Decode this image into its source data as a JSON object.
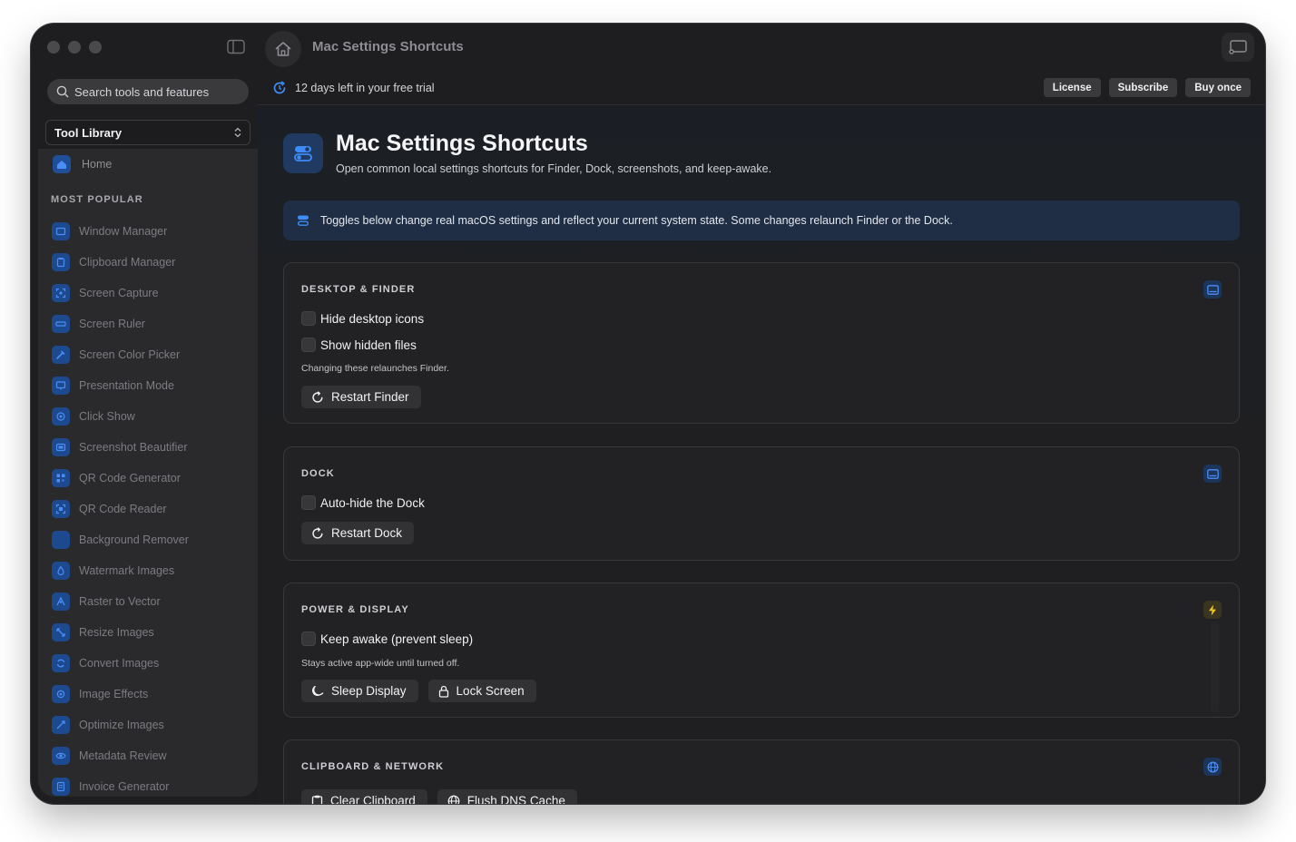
{
  "window": {
    "title": "Mac Settings Shortcuts"
  },
  "sidebar": {
    "search_placeholder": "Search tools and features",
    "library_label": "Tool Library",
    "home_label": "Home",
    "section_label": "MOST POPULAR",
    "items": [
      {
        "label": "Window Manager",
        "icon": "window-icon"
      },
      {
        "label": "Clipboard Manager",
        "icon": "clipboard-icon"
      },
      {
        "label": "Screen Capture",
        "icon": "capture-icon"
      },
      {
        "label": "Screen Ruler",
        "icon": "ruler-icon"
      },
      {
        "label": "Screen Color Picker",
        "icon": "eyedropper-icon"
      },
      {
        "label": "Presentation Mode",
        "icon": "presentation-icon"
      },
      {
        "label": "Click Show",
        "icon": "click-icon"
      },
      {
        "label": "Screenshot Beautifier",
        "icon": "beautifier-icon"
      },
      {
        "label": "QR Code Generator",
        "icon": "qr-icon"
      },
      {
        "label": "QR Code Reader",
        "icon": "qr-scan-icon"
      },
      {
        "label": "Background Remover",
        "icon": "background-remover-icon"
      },
      {
        "label": "Watermark Images",
        "icon": "drop-icon"
      },
      {
        "label": "Raster to Vector",
        "icon": "vector-icon"
      },
      {
        "label": "Resize Images",
        "icon": "resize-icon"
      },
      {
        "label": "Convert Images",
        "icon": "convert-icon"
      },
      {
        "label": "Image Effects",
        "icon": "effects-icon"
      },
      {
        "label": "Optimize Images",
        "icon": "optimize-icon"
      },
      {
        "label": "Metadata Review",
        "icon": "eye-icon"
      },
      {
        "label": "Invoice Generator",
        "icon": "invoice-icon"
      }
    ]
  },
  "trial": {
    "text": "12 days left in your free trial",
    "license": "License",
    "subscribe": "Subscribe",
    "buy_once": "Buy once"
  },
  "page": {
    "title": "Mac Settings Shortcuts",
    "subtitle": "Open common local settings shortcuts for Finder, Dock, screenshots, and keep-awake.",
    "notice": "Toggles below change real macOS settings and reflect your current system state. Some changes relaunch Finder or the Dock."
  },
  "sections": {
    "desktop": {
      "title": "DESKTOP & FINDER",
      "toggle1": "Hide desktop icons",
      "toggle1_checked": false,
      "toggle2": "Show hidden files",
      "toggle2_checked": false,
      "hint": "Changing these relaunches Finder.",
      "button": "Restart Finder"
    },
    "dock": {
      "title": "DOCK",
      "toggle1": "Auto-hide the Dock",
      "toggle1_checked": false,
      "button": "Restart Dock"
    },
    "power": {
      "title": "POWER & DISPLAY",
      "toggle1": "Keep awake (prevent sleep)",
      "toggle1_checked": false,
      "hint": "Stays active app-wide until turned off.",
      "button1": "Sleep Display",
      "button2": "Lock Screen"
    },
    "clipboard": {
      "title": "CLIPBOARD & NETWORK",
      "button1": "Clear Clipboard",
      "button2": "Flush DNS Cache"
    }
  },
  "colors": {
    "accent": "#2f7cf6",
    "window_bg": "#1e1e20",
    "sidebar_bg": "#2a2a2c",
    "card_bg": "#222224",
    "bolt": "#f5c518"
  }
}
